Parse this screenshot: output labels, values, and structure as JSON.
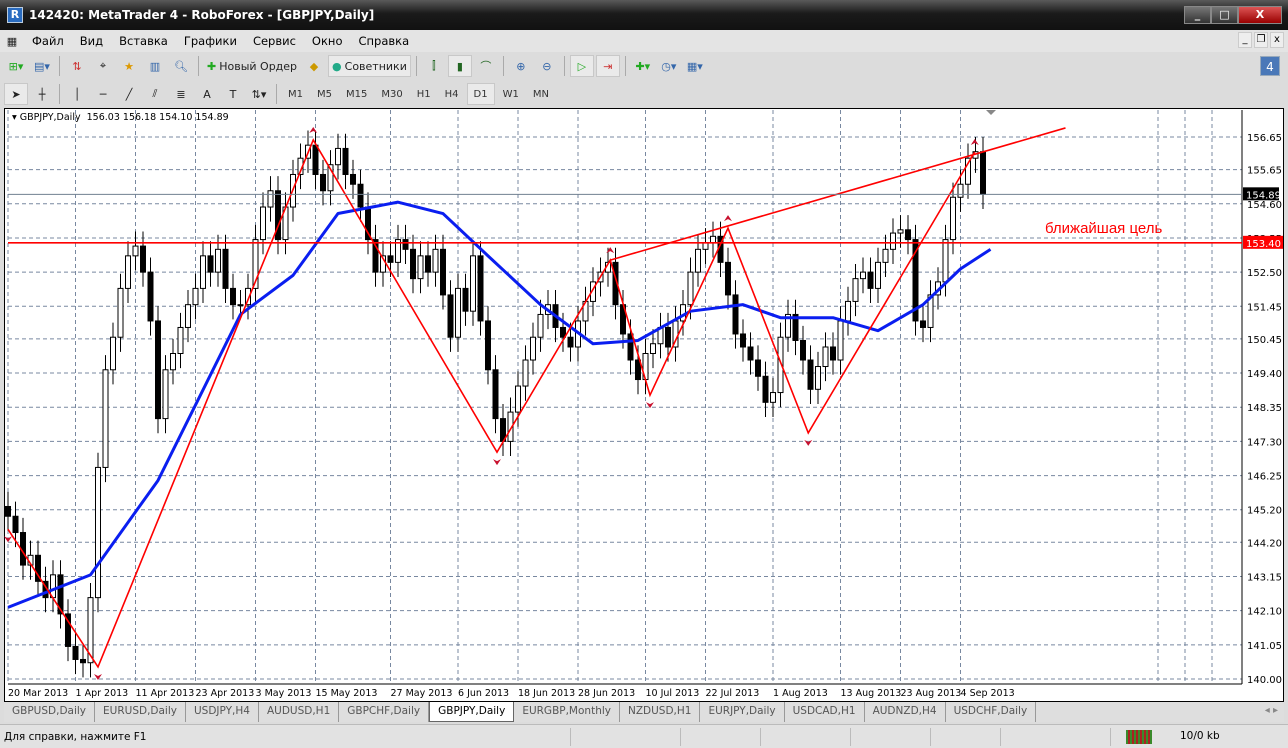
{
  "window": {
    "title": "142420: MetaTrader 4 - RoboForex - [GBPJPY,Daily]",
    "minimize": "_",
    "maximize": "□",
    "close": "X"
  },
  "menu": [
    "Файл",
    "Вид",
    "Вставка",
    "Графики",
    "Сервис",
    "Окно",
    "Справка"
  ],
  "mdi": {
    "minimize": "_",
    "restore": "❐",
    "close": "x"
  },
  "toolbar": {
    "new_order": "Новый Ордер",
    "experts": "Советники",
    "notifications": "4"
  },
  "timeframes": [
    "M1",
    "M5",
    "M15",
    "M30",
    "H1",
    "H4",
    "D1",
    "W1",
    "MN"
  ],
  "active_timeframe": "D1",
  "chart_header": {
    "symbol": "GBPJPY,Daily",
    "values": "156.03 156.18 154.10 154.89"
  },
  "annotation": "ближайшая цель",
  "colors": {
    "bull": "#ffffff",
    "bear": "#000000",
    "ma": "#0a1ef0",
    "lines": "#ff0000",
    "grid": "#7888a0"
  },
  "chart_data": {
    "type": "candlestick",
    "symbol": "GBPJPY",
    "timeframe": "Daily",
    "ylim": [
      140.0,
      157.1
    ],
    "y_ticks": [
      "156.65",
      "155.65",
      "154.60",
      "153.55",
      "152.50",
      "151.45",
      "150.45",
      "149.40",
      "148.35",
      "147.30",
      "146.25",
      "145.20",
      "144.20",
      "143.15",
      "142.10",
      "141.05",
      "140.00"
    ],
    "current_price": "154.89",
    "level_price": "153.40",
    "x_labels": [
      {
        "bar": 0,
        "text": "20 Mar 2013"
      },
      {
        "bar": 9,
        "text": "1 Apr 2013"
      },
      {
        "bar": 17,
        "text": "11 Apr 2013"
      },
      {
        "bar": 25,
        "text": "23 Apr 2013"
      },
      {
        "bar": 33,
        "text": "3 May 2013"
      },
      {
        "bar": 41,
        "text": "15 May 2013"
      },
      {
        "bar": 51,
        "text": "27 May 2013"
      },
      {
        "bar": 60,
        "text": "6 Jun 2013"
      },
      {
        "bar": 68,
        "text": "18 Jun 2013"
      },
      {
        "bar": 76,
        "text": "28 Jun 2013"
      },
      {
        "bar": 85,
        "text": "10 Jul 2013"
      },
      {
        "bar": 93,
        "text": "22 Jul 2013"
      },
      {
        "bar": 102,
        "text": "1 Aug 2013"
      },
      {
        "bar": 111,
        "text": "13 Aug 2013"
      },
      {
        "bar": 119,
        "text": "23 Aug 2013"
      },
      {
        "bar": 127,
        "text": "4 Sep 2013"
      }
    ],
    "closes": [
      145,
      144.5,
      143.5,
      143.8,
      143,
      142.5,
      143.2,
      142,
      141,
      140.6,
      140.5,
      142.5,
      146.5,
      149.5,
      150.5,
      152,
      153,
      153.3,
      152.5,
      151,
      148,
      149.5,
      150,
      150.8,
      151.5,
      152,
      153,
      152.5,
      153.2,
      152,
      151.5,
      151.5,
      152,
      153.5,
      154.5,
      155,
      153.5,
      154.5,
      155.5,
      156,
      156.4,
      155.5,
      155,
      155.8,
      156.3,
      155.5,
      155.2,
      154.5,
      153.5,
      152.5,
      153,
      152.8,
      153.5,
      153.2,
      152.3,
      153,
      152.5,
      153.2,
      151.8,
      150.5,
      152,
      151.3,
      153,
      151,
      149.5,
      148,
      147.3,
      148.2,
      149,
      149.8,
      150.5,
      151.2,
      151.5,
      150.8,
      150.5,
      150.2,
      151,
      151.6,
      152.2,
      152.5,
      152.8,
      151.5,
      150.6,
      149.8,
      149.2,
      150,
      150.3,
      150.8,
      150.2,
      151,
      151.5,
      152.5,
      153.2,
      153.4,
      153.6,
      152.8,
      151.8,
      150.6,
      150.2,
      149.8,
      149.3,
      148.5,
      148.8,
      150.5,
      151.2,
      150.4,
      149.8,
      148.9,
      149.6,
      150.2,
      149.8,
      151,
      151.6,
      152.3,
      152.5,
      152,
      152.8,
      153.2,
      153.7,
      153.8,
      153.5,
      151,
      150.8,
      151.8,
      152.2,
      153.5,
      154.8,
      155.2,
      156,
      156.2,
      154.89
    ],
    "moving_average": [
      [
        0,
        142.2
      ],
      [
        11,
        143.2
      ],
      [
        20,
        146.1
      ],
      [
        31,
        151.2
      ],
      [
        38,
        152.4
      ],
      [
        44,
        154.3
      ],
      [
        52,
        154.65
      ],
      [
        58,
        154.3
      ],
      [
        64,
        153.0
      ],
      [
        71,
        151.5
      ],
      [
        78,
        150.3
      ],
      [
        84,
        150.4
      ],
      [
        91,
        151.3
      ],
      [
        98,
        151.5
      ],
      [
        103,
        151.1
      ],
      [
        110,
        151.1
      ],
      [
        116,
        150.7
      ],
      [
        122,
        151.5
      ],
      [
        127,
        152.6
      ],
      [
        131,
        153.2
      ]
    ],
    "zigzag": [
      [
        0,
        144.6
      ],
      [
        12,
        140.37
      ],
      [
        40.7,
        156.56
      ],
      [
        65.2,
        146.97
      ],
      [
        80.3,
        152.87
      ],
      [
        85.6,
        148.72
      ],
      [
        96,
        153.85
      ],
      [
        106.7,
        147.56
      ],
      [
        128.9,
        156.19
      ]
    ],
    "trendline": [
      [
        80.3,
        152.87
      ],
      [
        141,
        156.93
      ]
    ]
  },
  "tabs": [
    "GBPUSD,Daily",
    "EURUSD,Daily",
    "USDJPY,H4",
    "AUDUSD,H1",
    "GBPCHF,Daily",
    "GBPJPY,Daily",
    "EURGBP,Monthly",
    "NZDUSD,H1",
    "EURJPY,Daily",
    "USDCAD,H1",
    "AUDNZD,H4",
    "USDCHF,Daily"
  ],
  "active_tab": "GBPJPY,Daily",
  "status": {
    "help": "Для справки, нажмите F1",
    "traffic": "10/0 kb"
  }
}
